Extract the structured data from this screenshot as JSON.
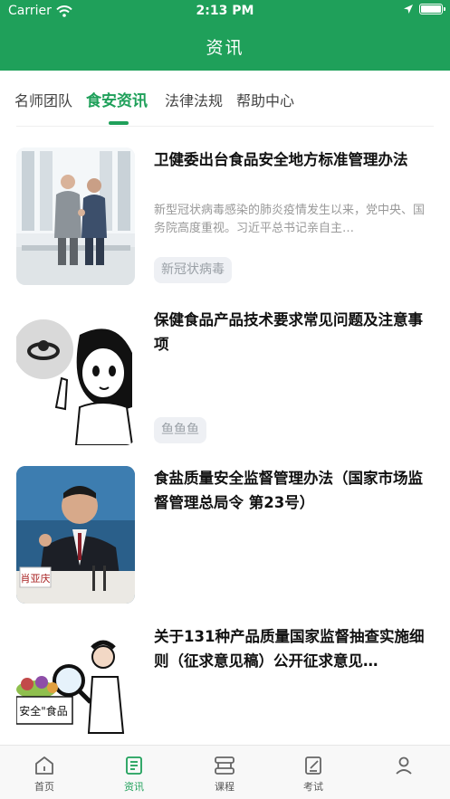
{
  "status_bar": {
    "carrier": "Carrier",
    "time": "2:13 PM"
  },
  "header": {
    "title": "资讯"
  },
  "tabs": [
    {
      "label": "名师团队"
    },
    {
      "label": "食安资讯"
    },
    {
      "label": "法律法规"
    },
    {
      "label": "帮助中心"
    }
  ],
  "active_tab": "食安资讯",
  "news": [
    {
      "title": "卫健委出台食品安全地方标准管理办法",
      "summary": "新型冠状病毒感染的肺炎疫情发生以来，党中央、国务院高度重视。习近平总书记亲自主…",
      "tag": "新冠状病毒",
      "image": "two-men-handshake-office"
    },
    {
      "title": "保健食品产品技术要求常见问题及注意事项",
      "summary": "",
      "tag": "鱼鱼鱼",
      "image": "cartoon-girl-pointing"
    },
    {
      "title": "食盐质量安全监督管理办法（国家市场监督管理总局令 第23号）",
      "summary": "",
      "tag": "",
      "image": "official-press-conference",
      "image_caption": "肖亚庆"
    },
    {
      "title": "关于131种产品质量国家监督抽查实施细则（征求意见稿）公开征求意见…",
      "summary": "",
      "tag": "",
      "image": "cartoon-food-inspection",
      "image_caption": "安全\"食品"
    }
  ],
  "tabbar": [
    {
      "label": "首页",
      "icon": "home-icon"
    },
    {
      "label": "资讯",
      "icon": "news-icon"
    },
    {
      "label": "课程",
      "icon": "course-icon"
    },
    {
      "label": "考试",
      "icon": "exam-icon"
    },
    {
      "label": "",
      "icon": "profile-icon"
    }
  ],
  "colors": {
    "primary": "#1fa05a",
    "tag_bg": "#eef0f4",
    "tag_text": "#9aa0a6"
  }
}
